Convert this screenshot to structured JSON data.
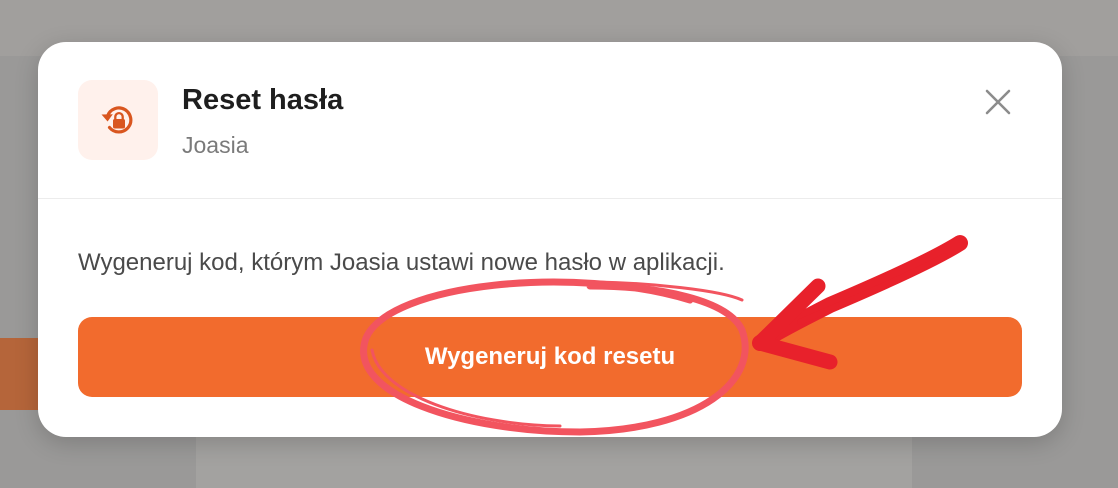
{
  "dialog": {
    "title": "Reset hasła",
    "subtitle": "Joasia",
    "description": "Wygeneruj kod, którym Joasia ustawi nowe hasło w aplikacji.",
    "primary_button_label": "Wygeneruj kod resetu",
    "header_icon": "lock-reset-icon",
    "close_icon": "close-icon"
  },
  "colors": {
    "accent": "#f26b2d",
    "icon_background": "#fff1ec",
    "annotation_circle": "#f2545f",
    "annotation_arrow": "#e8212b"
  }
}
